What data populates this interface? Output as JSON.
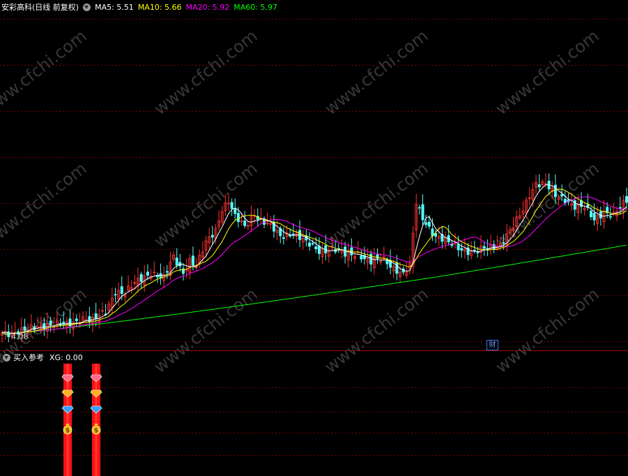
{
  "header": {
    "stock_title": "安彩高科(日线 前复权)",
    "indicators": [
      {
        "label": "MA5: 5.51",
        "color": "#ffffff"
      },
      {
        "label": "MA10: 5.66",
        "color": "#ffff00"
      },
      {
        "label": "MA20: 5.92",
        "color": "#ff00ff"
      },
      {
        "label": "MA60: 5.97",
        "color": "#00ff00"
      }
    ]
  },
  "main_chart": {
    "low_label": "4.08",
    "finance_marker": "财",
    "watermark": "www.cfchi.com"
  },
  "sub_chart": {
    "title": "买入参考",
    "value_label": "XG: 0.00"
  },
  "colors": {
    "up": "#ff3232",
    "down": "#54ffff",
    "ma5": "#ffffff",
    "ma10": "#ffff00",
    "ma20": "#ff00ff",
    "ma60": "#00ff00",
    "grid": "#7a0000",
    "signal_bar": "#ff1010"
  },
  "icons": {
    "signal_icons": [
      "red-diamond-icon",
      "gold-diamond-icon",
      "blue-diamond-icon",
      "money-bag-icon"
    ]
  },
  "chart_data": {
    "type": "candlestick",
    "series": [
      {
        "name": "MA5",
        "value": 5.51
      },
      {
        "name": "MA10",
        "value": 5.66
      },
      {
        "name": "MA20",
        "value": 5.92
      },
      {
        "name": "MA60",
        "value": 5.97
      }
    ],
    "annotations": [
      "4.08"
    ]
  }
}
